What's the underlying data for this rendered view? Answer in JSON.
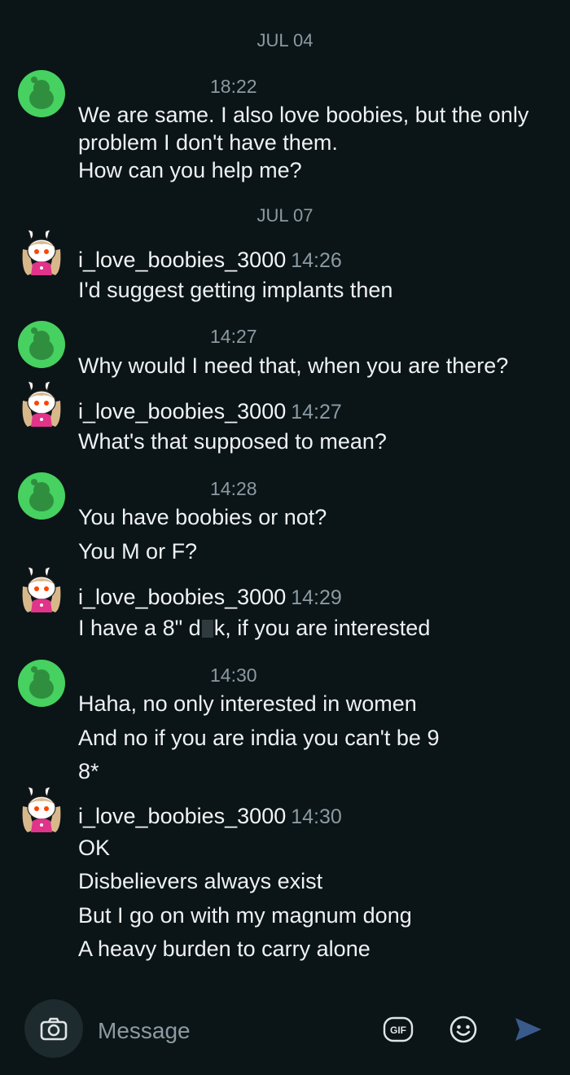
{
  "dates": [
    "JUL 04",
    "JUL 07"
  ],
  "messages": [
    {
      "time": "18:22",
      "lines": [
        "We are same. I also love boobies, but the only",
        "problem I don't have them.",
        "How can you help me?"
      ]
    },
    {
      "user": "i_love_boobies_3000",
      "time": "14:26",
      "lines": [
        "I'd suggest getting implants then"
      ]
    },
    {
      "time": "14:27",
      "lines": [
        "Why would I need that, when you are there?"
      ]
    },
    {
      "user": "i_love_boobies_3000",
      "time": "14:27",
      "lines": [
        "What's that supposed to mean?"
      ]
    },
    {
      "time": "14:28",
      "lines": [
        "You have boobies or not?",
        "You M or F?"
      ]
    },
    {
      "user": "i_love_boobies_3000",
      "time": "14:29",
      "line_pre": "I have a 8\" d",
      "line_post": "k, if you are interested"
    },
    {
      "time": "14:30",
      "lines": [
        "Haha, no only interested in women",
        "And no if you are india you can't be 9",
        "8*"
      ]
    },
    {
      "user": "i_love_boobies_3000",
      "time": "14:30",
      "lines": [
        "OK",
        "Disbelievers always exist",
        "But I go on with my magnum dong",
        "A heavy burden to carry alone"
      ]
    }
  ],
  "composer": {
    "placeholder": "Message"
  },
  "icons": {
    "camera": "camera-icon",
    "gif": "gif-icon",
    "emoji": "emoji-icon",
    "send": "send-icon",
    "gif_text": "GIF"
  },
  "colors": {
    "background": "#0b1416",
    "avatar_green": "#46d160",
    "accent_send": "#3a5a8c",
    "muted": "#8b9aa3"
  }
}
